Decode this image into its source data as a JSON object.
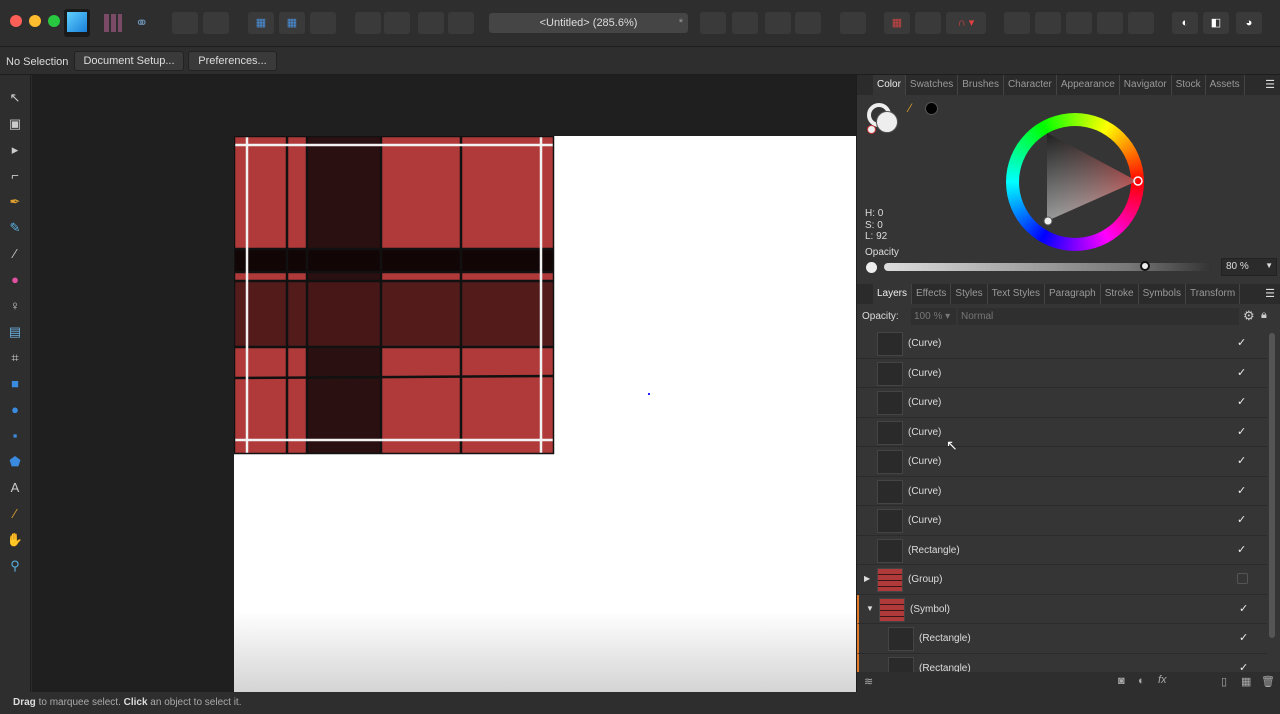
{
  "toolbar": {
    "document_title": "<Untitled> (285.6%)",
    "modified_marker": "*"
  },
  "context": {
    "selection": "No Selection",
    "document_setup": "Document Setup...",
    "preferences": "Preferences..."
  },
  "color_panel": {
    "tabs": [
      "Color",
      "Swatches",
      "Brushes",
      "Character",
      "Appearance",
      "Navigator",
      "Stock",
      "Assets"
    ],
    "h": "H: 0",
    "s": "S: 0",
    "l": "L: 92",
    "opacity_label": "Opacity",
    "opacity_value": "80 %",
    "opacity": 0.8
  },
  "layers_panel": {
    "tabs": [
      "Layers",
      "Effects",
      "Styles",
      "Text Styles",
      "Paragraph",
      "Stroke",
      "Symbols",
      "Transform"
    ],
    "opacity_label": "Opacity:",
    "opacity_value": "100 %",
    "blend_mode": "Normal",
    "layers": [
      {
        "name": "(Curve)",
        "visible": true
      },
      {
        "name": "(Curve)",
        "visible": true
      },
      {
        "name": "(Curve)",
        "visible": true
      },
      {
        "name": "(Curve)",
        "visible": true
      },
      {
        "name": "(Curve)",
        "visible": true
      },
      {
        "name": "(Curve)",
        "visible": true
      },
      {
        "name": "(Curve)",
        "visible": true
      },
      {
        "name": "(Rectangle)",
        "visible": true
      },
      {
        "name": "(Group)",
        "visible": false,
        "expander": "▶"
      },
      {
        "name": "(Symbol)",
        "visible": true,
        "expander": "▼"
      },
      {
        "name": "(Rectangle)",
        "visible": true,
        "child": true
      },
      {
        "name": "(Rectangle)",
        "visible": true,
        "child": true
      }
    ]
  },
  "status": {
    "drag": "Drag",
    "t1": " to marquee select. ",
    "click": "Click",
    "t2": " an object to select it."
  },
  "colors": {
    "plaid_red": "#b03a3a",
    "accent_orange": "#e07a2a"
  }
}
